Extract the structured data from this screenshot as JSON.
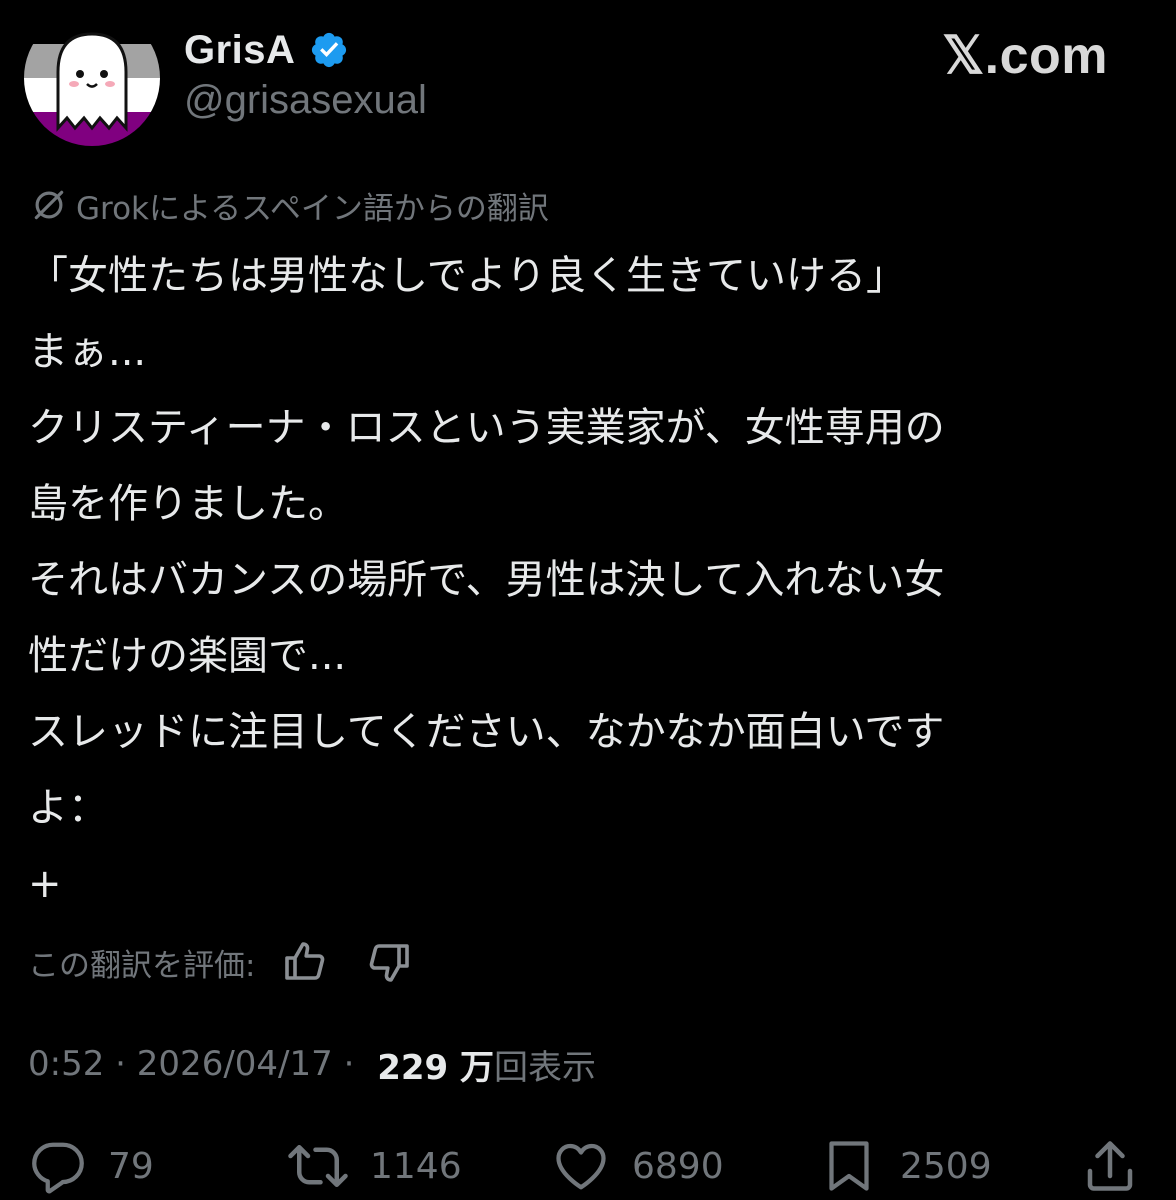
{
  "author": {
    "display_name": "GrisA",
    "handle": "@grisasexual",
    "verified": true,
    "avatar_icon": "ghost-avatar-icon"
  },
  "site_mark": "𝕏.com",
  "translation": {
    "label": "Grokによるスペイン語からの翻訳",
    "icon": "grok-icon"
  },
  "tweet": {
    "lines": [
      "「女性たちは男性なしでより良く生きていける」",
      "まぁ...",
      "クリスティーナ・ロスという実業家が、女性専用の",
      "島を作りました。",
      "それはバカンスの場所で、男性は決して入れない女",
      "性だけの楽園で...",
      "スレッドに注目してください、なかなか面白いです",
      "よ：",
      "+"
    ]
  },
  "rate": {
    "label": "この翻訳を評価:",
    "up_icon": "thumbs-up-icon",
    "down_icon": "thumbs-down-icon"
  },
  "meta": {
    "time": "0:52",
    "separator": " · ",
    "date": "2026/04/17",
    "views_number": "229 万",
    "views_unit": "回表示"
  },
  "actions": {
    "replies": "79",
    "reposts": "1146",
    "likes": "6890",
    "bookmarks": "2509"
  },
  "colors": {
    "background": "#000000",
    "text_primary": "#e7e9ea",
    "text_secondary": "#71767b",
    "verified_blue": "#1d9bf0"
  }
}
